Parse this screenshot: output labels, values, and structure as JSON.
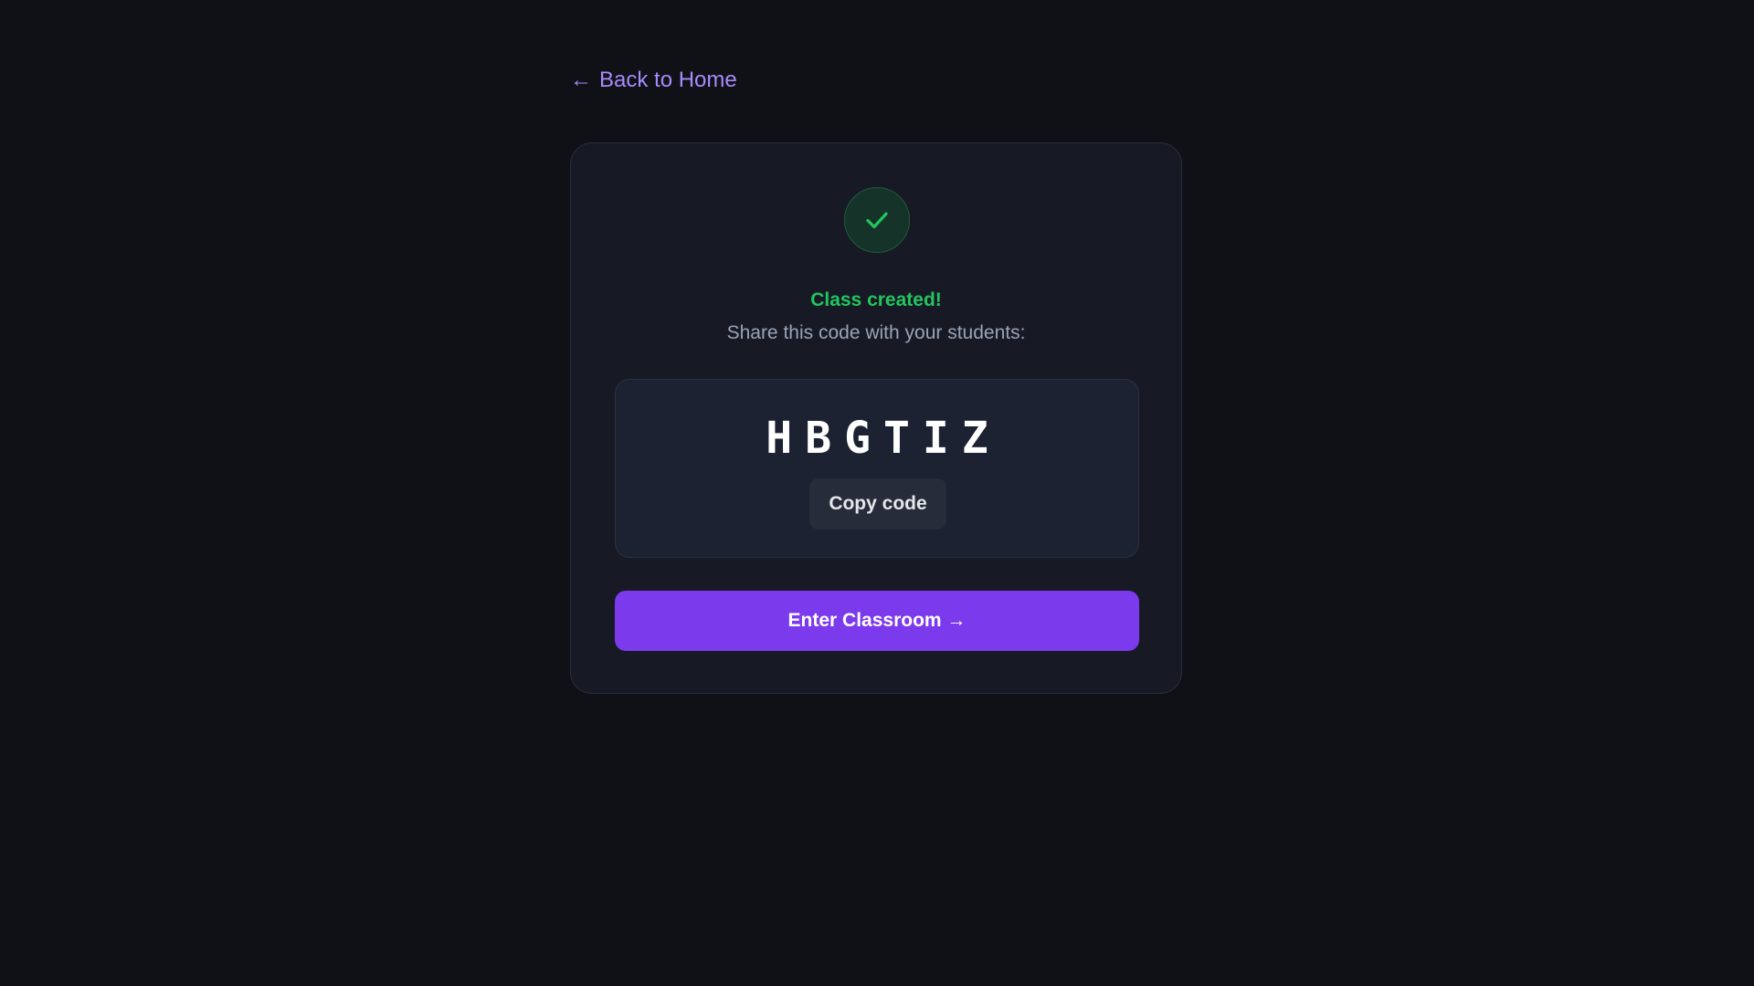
{
  "nav": {
    "back_arrow": "←",
    "back_label": "Back to Home"
  },
  "status": {
    "icon": "checkmark-icon",
    "title": "Class created!",
    "subtitle": "Share this code with your students:"
  },
  "code": {
    "value": "HBGTIZ",
    "copy_label": "Copy code"
  },
  "actions": {
    "enter_label": "Enter Classroom →"
  },
  "colors": {
    "background": "#101116",
    "card": "#171a25",
    "accent": "#7c3aed",
    "link": "#a78bfa",
    "success": "#22c55e"
  }
}
